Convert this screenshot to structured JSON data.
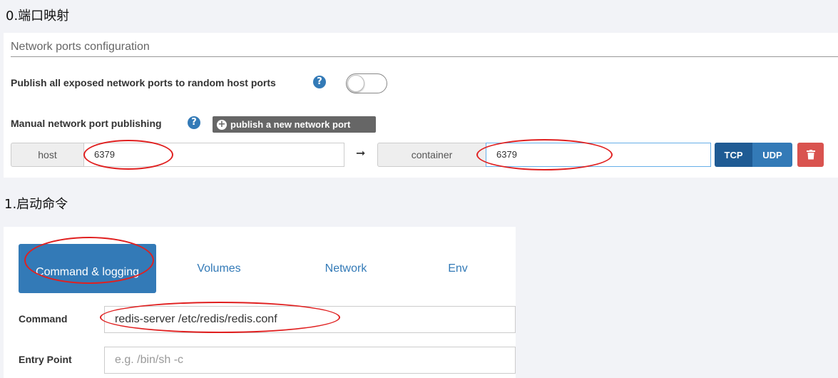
{
  "headings": {
    "step0": "0.端口映射",
    "step1": "1.启动命令"
  },
  "ports": {
    "section_title": "Network ports configuration",
    "publish_all_label": "Publish all exposed network ports to random host ports",
    "publish_all_enabled": false,
    "manual_label": "Manual network port publishing",
    "publish_button_label": "publish a new network port",
    "help_glyph": "?",
    "mapping": {
      "host_label": "host",
      "host_value": "6379",
      "arrow": "➞",
      "container_label": "container",
      "container_value": "6379",
      "protocols": [
        "TCP",
        "UDP"
      ],
      "selected_protocol": "TCP"
    }
  },
  "container_config": {
    "tabs": [
      "Command & logging",
      "Volumes",
      "Network",
      "Env"
    ],
    "active_tab": "Command & logging",
    "command_label": "Command",
    "command_value": "redis-server /etc/redis/redis.conf",
    "entry_point_label": "Entry Point",
    "entry_point_placeholder": "e.g. /bin/sh -c"
  },
  "colors": {
    "primary": "#337ab7",
    "primary_dark": "#1f5b94",
    "danger": "#d9534f",
    "annotation": "#e02020"
  }
}
